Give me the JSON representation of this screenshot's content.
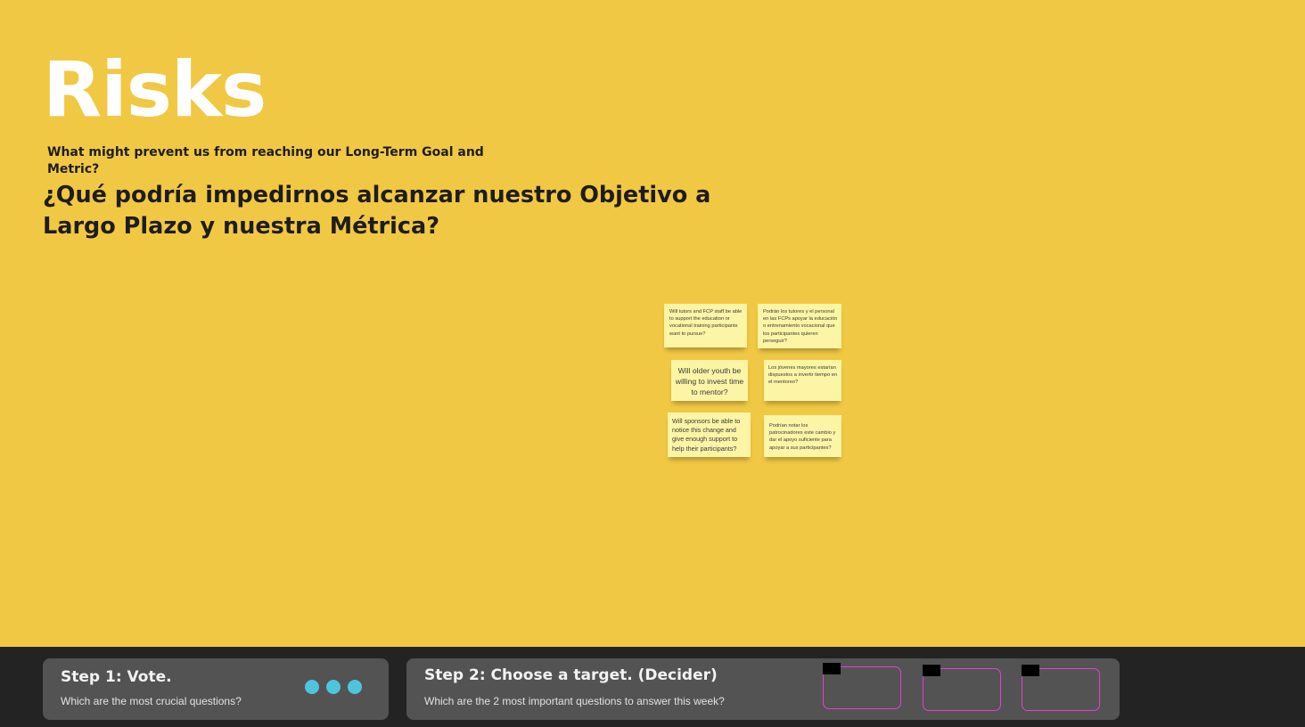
{
  "header": {
    "title": "Risks",
    "subtitle_en": "What might prevent us from reaching our Long-Term Goal and Metric?",
    "subtitle_es": "¿Qué podría impedirnos alcanzar nuestro Objetivo a Largo Plazo y nuestra Métrica?"
  },
  "stickies": [
    {
      "text": "Will tutors and FCP staff be able to support the education or vocational training participants want to pursue?"
    },
    {
      "text": "Podrán los tutores y el personal en las FCPs apoyar la educación o entrenamiento vocacional que los participantes quieren perseguir?"
    },
    {
      "text": "Will older youth be willing to invest time to mentor?"
    },
    {
      "text": "Los jóvenes mayores estarían dispuestos a invertir tiempo en el mentoreo?"
    },
    {
      "text": "Will sponsors be able to notice this change and give enough support to help their participants?"
    },
    {
      "text": "Podrían notar los patrocinadores este cambio y dar el apoyo suficiente para apoyar a sus participantes?"
    }
  ],
  "steps": {
    "vote": {
      "title": "Step 1: Vote.",
      "description": "Which are the most crucial questions?",
      "dot_color": "#4fc4dd"
    },
    "target": {
      "title": "Step 2: Choose a target. (Decider)",
      "description": "Which are the 2 most important questions to answer this week?",
      "slot_color": "#e63fd1"
    }
  },
  "colors": {
    "background": "#f1c844",
    "sticky": "#fdf5a6",
    "bottom_bar": "#232323",
    "panel": "#535353"
  }
}
